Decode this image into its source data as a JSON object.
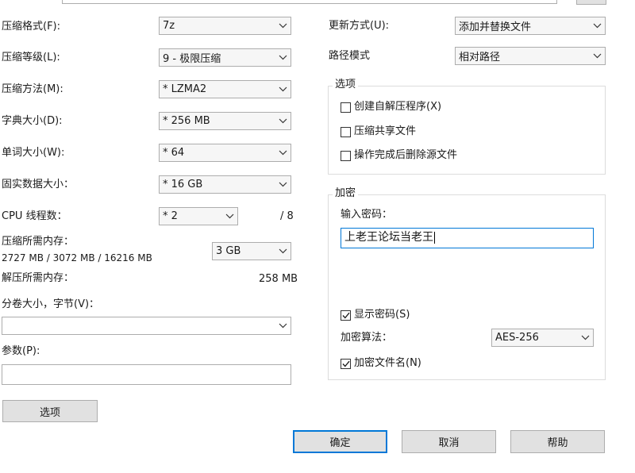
{
  "left": {
    "format_label": "压缩格式(F):",
    "format_value": "7z",
    "level_label": "压缩等级(L):",
    "level_value": "9 - 极限压缩",
    "method_label": "压缩方法(M):",
    "method_value": "* LZMA2",
    "dict_label": "字典大小(D):",
    "dict_value": "* 256 MB",
    "word_label": "单词大小(W):",
    "word_value": "* 64",
    "solid_label": "固实数据大小：",
    "solid_value": "* 16 GB",
    "threads_label": "CPU 线程数：",
    "threads_value": "* 2",
    "threads_total": "/ 8",
    "mem_compress_label": "压缩所需内存：",
    "mem_compress_detail": "2727 MB / 3072 MB / 16216 MB",
    "mem_compress_value": "3 GB",
    "mem_decompress_label": "解压所需内存：",
    "mem_decompress_value": "258 MB",
    "volume_label": "分卷大小，字节(V)：",
    "volume_value": "",
    "params_label": "参数(P):",
    "params_value": "",
    "options_button": "选项"
  },
  "right": {
    "update_label": "更新方式(U):",
    "update_value": "添加并替换文件",
    "path_label": "路径模式",
    "path_value": "相对路径",
    "options_group": {
      "title": "选项",
      "sfx": {
        "label": "创建自解压程序(X)",
        "checked": false
      },
      "shared": {
        "label": "压缩共享文件",
        "checked": false
      },
      "delete": {
        "label": "操作完成后删除源文件",
        "checked": false
      }
    },
    "encrypt_group": {
      "title": "加密",
      "password_label": "输入密码：",
      "password_value": "上老王论坛当老王",
      "show_password": {
        "label": "显示密码(S)",
        "checked": true
      },
      "algo_label": "加密算法：",
      "algo_value": "AES-256",
      "encrypt_names": {
        "label": "加密文件名(N)",
        "checked": true
      }
    }
  },
  "footer": {
    "ok": "确定",
    "cancel": "取消",
    "help": "帮助"
  }
}
